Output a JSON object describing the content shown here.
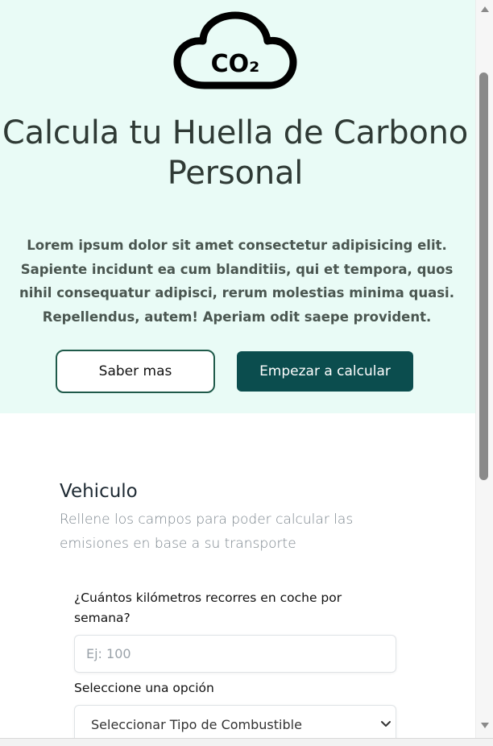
{
  "hero": {
    "icon": "co2-cloud-icon",
    "icon_text": "CO₂",
    "title": "Calcula tu Huella de Carbono Personal",
    "description": "Lorem ipsum dolor sit amet consectetur adipisicing elit. Sapiente incidunt ea cum blanditiis, qui et tempora, quos nihil consequatur adipisci, rerum molestias minima quasi. Repellendus, autem! Aperiam odit saepe provident.",
    "btn_more": "Saber mas",
    "btn_start": "Empezar a calcular",
    "bg_color": "#e9fbf6",
    "accent_color": "#0b4d4e"
  },
  "vehicle_section": {
    "title": "Vehiculo",
    "subtitle": "Rellene los campos para poder calcular las emisiones en base a su transporte",
    "km_label": "¿Cuántos kilómetros recorres en coche por semana?",
    "km_placeholder": "Ej: 100",
    "km_value": "",
    "option_label": "Seleccione una opción",
    "fuel_select_value": "Seleccionar Tipo de Combustible"
  }
}
